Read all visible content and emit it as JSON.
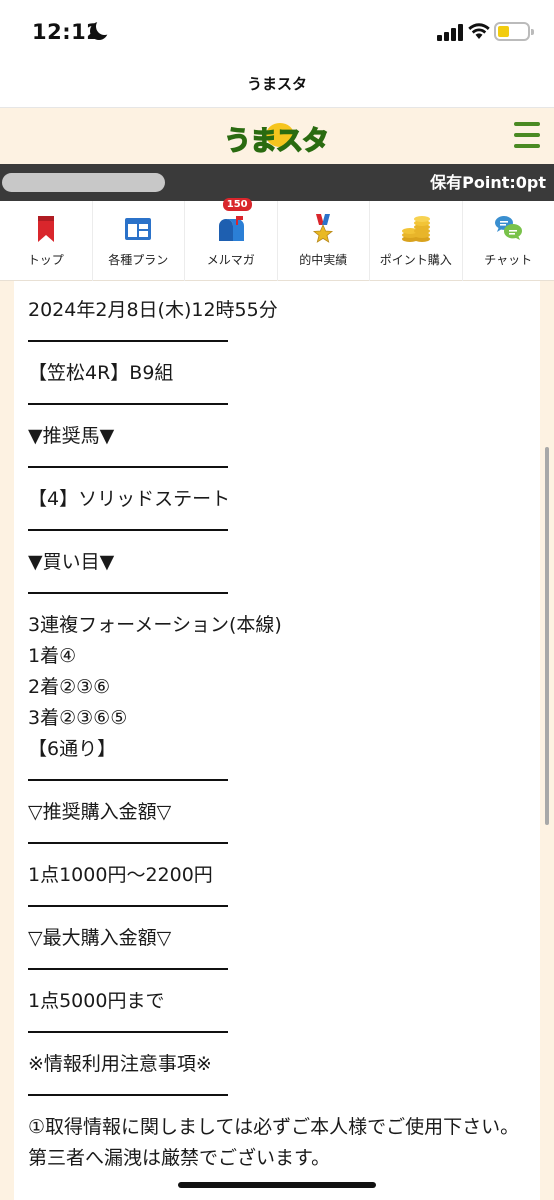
{
  "status_bar": {
    "time": "12:12"
  },
  "browser": {
    "title": "うまスタ"
  },
  "site": {
    "logo_text": "うまスタ"
  },
  "point_bar": {
    "points_label": "保有Point:0pt"
  },
  "nav": {
    "items": [
      {
        "label": "トップ",
        "icon": "bookmark-icon"
      },
      {
        "label": "各種プラン",
        "icon": "plan-icon"
      },
      {
        "label": "メルマガ",
        "icon": "mailbox-icon",
        "badge": "150"
      },
      {
        "label": "的中実績",
        "icon": "medal-icon"
      },
      {
        "label": "ポイント購入",
        "icon": "coins-icon"
      },
      {
        "label": "チャット",
        "icon": "chat-icon"
      }
    ]
  },
  "article": {
    "date": "2024年2月8日(木)12時55分",
    "race": "【笠松4R】B9組",
    "rec_heading": "▼推奨馬▼",
    "rec_horse": "【4】ソリッドステート",
    "buy_heading": "▼買い目▼",
    "bet_type": "3連複フォーメーション(本線)",
    "first": "1着④",
    "second": "2着②③⑥",
    "third": "3着②③⑥⑤",
    "combos": "【6通り】",
    "rec_amount_heading": "▽推奨購入金額▽",
    "rec_amount": "1点1000円〜2200円",
    "max_amount_heading": "▽最大購入金額▽",
    "max_amount": "1点5000円まで",
    "notice_heading": "※情報利用注意事項※",
    "notice_1": "①取得情報に関しましては必ずご本人様でご使用下さい。第三者へ漏洩は厳禁でございます。"
  }
}
